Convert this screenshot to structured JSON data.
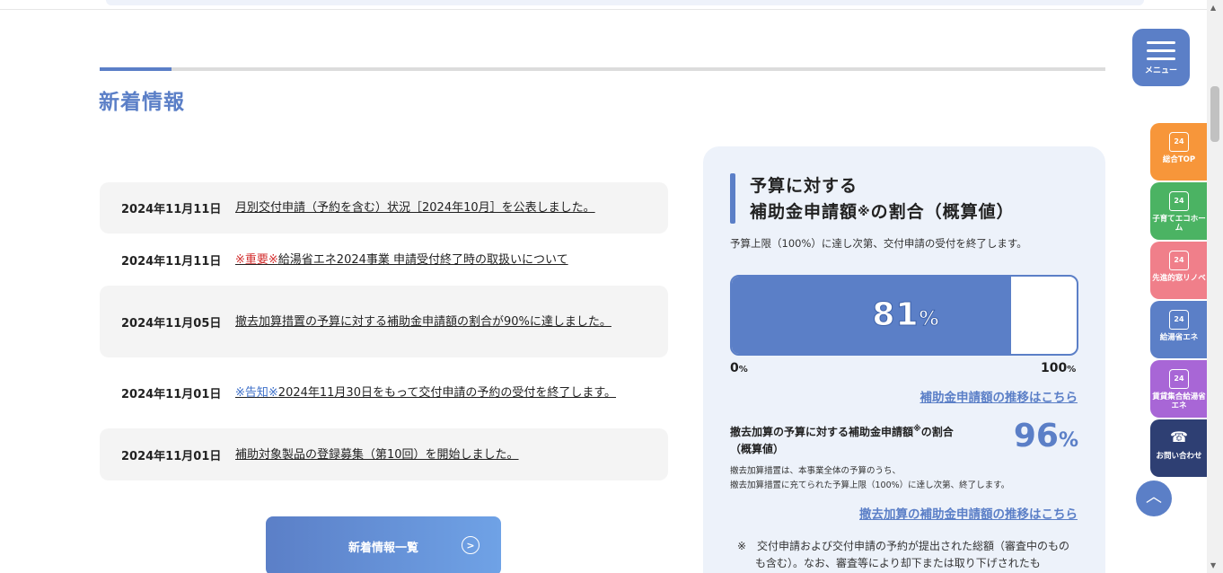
{
  "section": {
    "title": "新着情報"
  },
  "news": [
    {
      "date": "2024年11月11日",
      "prefix": "",
      "prefix_color": "",
      "text": "月別交付申請（予約を含む）状況［2024年10月］を公表しました。"
    },
    {
      "date": "2024年11月11日",
      "prefix": "※重要※",
      "prefix_color": "#d32f2f",
      "text": "給湯省エネ2024事業 申請受付終了時の取扱いについて"
    },
    {
      "date": "2024年11月05日",
      "prefix": "",
      "prefix_color": "",
      "text": "撤去加算措置の予算に対する補助金申請額の割合が90%に達しました。"
    },
    {
      "date": "2024年11月01日",
      "prefix": "※告知※",
      "prefix_color": "#3d6fc9",
      "text": "2024年11月30日をもって交付申請の予約の受付を終了します。"
    },
    {
      "date": "2024年11月01日",
      "prefix": "",
      "prefix_color": "",
      "text": "補助対象製品の登録募集（第10回）を開始しました。"
    }
  ],
  "more_button": {
    "label": "新着情報一覧",
    "icon": "circle-arrow-right-icon"
  },
  "budget": {
    "title_line1": "予算に対する",
    "title_line2": "補助金申請額",
    "title_mark": "※",
    "title_line2_suffix": "の割合（概算値）",
    "note": "予算上限（100%）に達し次第、交付申請の受付を終了します。",
    "progress_value": 81,
    "progress_unit": "%",
    "scale_min": "0",
    "scale_max": "100",
    "scale_unit": "%",
    "history_link": "補助金申請額の推移はこちら",
    "removal_label": "撤去加算の予算に対する補助金申請額",
    "removal_mark": "※",
    "removal_label_suffix": "の割合",
    "removal_label_line2": "（概算値）",
    "removal_value": 96,
    "removal_unit": "%",
    "removal_note_line1": "撤去加算措置は、本事業全体の予算のうち、",
    "removal_note_line2": "撤去加算措置に充てられた予算上限（100%）に達し次第、終了します。",
    "removal_link": "撤去加算の補助金申請額の推移はこちら",
    "footnote": "※　交付申請および交付申請の予約が提出された総額（審査中のものも含む）。なお、審査等により却下または取り下げされたも"
  },
  "menu": {
    "label": "メニュー",
    "icon": "hamburger-icon"
  },
  "side_tabs": [
    {
      "label": "総合TOP",
      "color": "#f7963a",
      "icon": "house-24-icon"
    },
    {
      "label": "子育てエコホーム",
      "color": "#4bb363",
      "icon": "heart-house-24-icon"
    },
    {
      "label": "先進的窓リノベ",
      "color": "#f07f8a",
      "icon": "window-24-icon"
    },
    {
      "label": "給湯省エネ",
      "color": "#5b7fc7",
      "icon": "drop-house-24-icon"
    },
    {
      "label": "賃貸集合給湯省エネ",
      "color": "#a866d6",
      "icon": "building-24-icon"
    },
    {
      "label": "お問い合わせ",
      "color": "#2e3f73",
      "icon": "phone-icon"
    }
  ],
  "colors": {
    "accent": "#5b7fc7",
    "card_bg": "#edf2fa",
    "important": "#d32f2f"
  }
}
